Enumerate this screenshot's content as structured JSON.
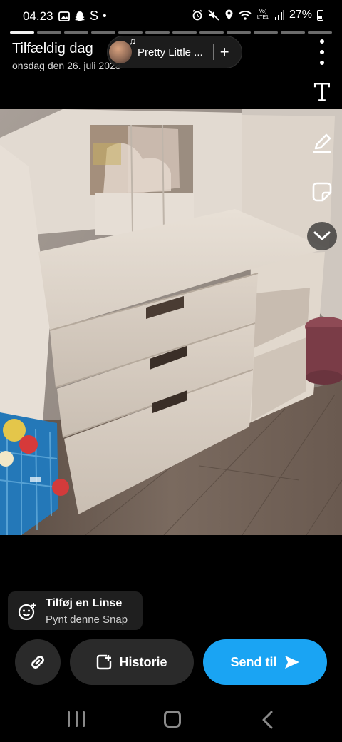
{
  "status_bar": {
    "time": "04.23",
    "carrier_letter": "S",
    "network": "Vo) LTE1",
    "battery": "27%"
  },
  "story_progress": {
    "segments": 12,
    "active_segments": 1
  },
  "header": {
    "title": "Tilfældig dag",
    "date": "onsdag den 26. juli 2023",
    "music": {
      "title": "Pretty Little ...",
      "add_symbol": "+"
    }
  },
  "tools": {
    "text_glyph": "T",
    "icons": [
      "text-icon",
      "pencil-icon",
      "sticker-icon",
      "chevron-down-icon"
    ]
  },
  "lens": {
    "title": "Tilføj en Linse",
    "subtitle": "Pynt denne Snap"
  },
  "actions": {
    "story_label": "Historie",
    "send_label": "Send til",
    "send_color": "#1aa4f3"
  }
}
